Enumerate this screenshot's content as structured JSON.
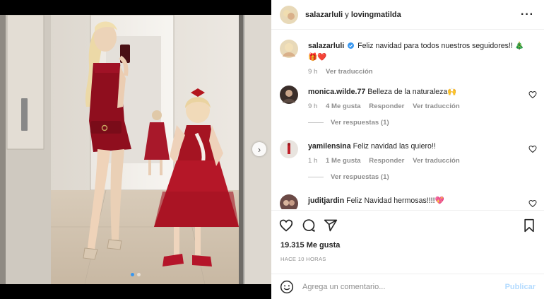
{
  "post": {
    "header": {
      "author": "salazarluli",
      "connector": " y ",
      "coauthor": "lovingmatilda",
      "more_icon": "more-horizontal-icon"
    },
    "photo": {
      "description_icon": "photo-icon",
      "next_icon": "chevron-right-icon",
      "slides_total": 2,
      "slide_active": 1
    },
    "caption": {
      "user": "salazarluli",
      "verified": true,
      "text": "Feliz navidad para todos nuestros seguidores!! 🎄🎁❤️",
      "time": "9 h",
      "translate": "Ver traducción"
    },
    "comments": [
      {
        "user": "monica.wilde.77",
        "text": "Belleza de la naturaleza🙌",
        "time": "9 h",
        "likes": "4 Me gusta",
        "reply": "Responder",
        "translate": "Ver traducción",
        "replies": "Ver respuestas (1)"
      },
      {
        "user": "yamilensina",
        "text": "Feliz navidad las quiero!!",
        "time": "1 h",
        "likes": "1 Me gusta",
        "reply": "Responder",
        "translate": "Ver traducción",
        "replies": "Ver respuestas (1)"
      },
      {
        "user": "juditjardin",
        "text": "Feliz Navidad hermosas!!!!💖"
      }
    ],
    "likes": "19.315 Me gusta",
    "posted": "HACE 10 HORAS",
    "add_comment": {
      "placeholder": "Agrega un comentario...",
      "submit": "Publicar"
    },
    "colors": {
      "link_blue": "#0095f6",
      "publish_disabled": "#b3dbff",
      "meta_gray": "#8e8e8e"
    }
  }
}
